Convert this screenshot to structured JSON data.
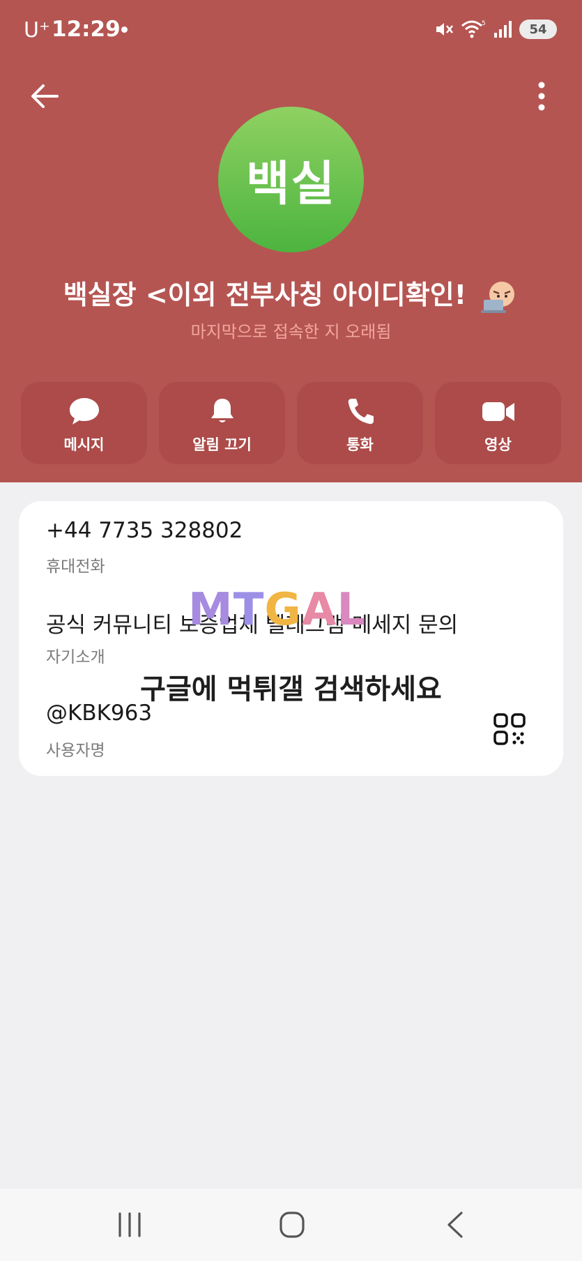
{
  "status_bar": {
    "carrier": "U⁺",
    "time": "12:29",
    "battery": "54",
    "icons": [
      "notification-dot",
      "mute-icon",
      "wifi-icon",
      "signal-icon",
      "battery-icon"
    ]
  },
  "header": {
    "background_color": "#b55552",
    "back_icon": "back-arrow-icon",
    "menu_icon": "more-vertical-icon"
  },
  "profile": {
    "avatar_text": "백실",
    "avatar_color": "#5cbf46",
    "name": "백실장 <이외 전부사칭 아이디확인!",
    "status": "마지막으로 접속한 지 오래됨"
  },
  "actions": [
    {
      "label": "메시지",
      "icon": "chat-bubble-icon"
    },
    {
      "label": "알림 끄기",
      "icon": "bell-icon"
    },
    {
      "label": "통화",
      "icon": "phone-icon"
    },
    {
      "label": "영상",
      "icon": "video-camera-icon"
    }
  ],
  "info": {
    "phone": {
      "value": "+44 7735 328802",
      "label": "휴대전화"
    },
    "bio": {
      "value": "공식 커뮤니티 보증업체 텔레그램 메세지 문의",
      "label": "자기소개"
    },
    "username": {
      "value": "@KBK963",
      "label": "사용자명"
    },
    "qr_icon": "qr-code-icon"
  },
  "watermark": {
    "logo": "MTGAL",
    "text": "구글에 먹튀갤 검색하세요"
  },
  "nav_bar": {
    "icons": [
      "recent-apps-icon",
      "home-icon",
      "back-icon"
    ]
  }
}
